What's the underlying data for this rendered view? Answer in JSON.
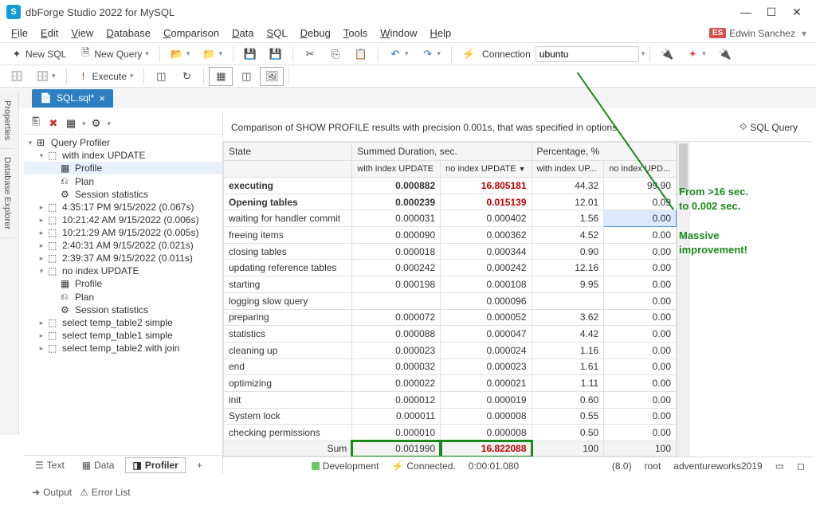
{
  "app": {
    "title": "dbForge Studio 2022 for MySQL",
    "icon_letter": "S"
  },
  "user": {
    "badge": "ES",
    "name": "Edwin Sanchez"
  },
  "menu": [
    "File",
    "Edit",
    "View",
    "Database",
    "Comparison",
    "Data",
    "SQL",
    "Debug",
    "Tools",
    "Window",
    "Help"
  ],
  "toolbar1": {
    "new_sql": "New SQL",
    "new_query": "New Query",
    "connection_label": "Connection",
    "connection_value": "ubuntu"
  },
  "toolbar2": {
    "execute": "Execute"
  },
  "dock_tabs": [
    "Properties",
    "Database Explorer"
  ],
  "document": {
    "tab_label": "SQL.sql*"
  },
  "tree": {
    "root": "Query Profiler",
    "nodes": [
      {
        "d": 1,
        "t": "-",
        "i": "⬚",
        "l": "with index UPDATE"
      },
      {
        "d": 2,
        "t": "",
        "i": "▦",
        "l": "Profile",
        "active": true
      },
      {
        "d": 2,
        "t": "",
        "i": "⎌",
        "l": "Plan"
      },
      {
        "d": 2,
        "t": "",
        "i": "⚙",
        "l": "Session statistics"
      },
      {
        "d": 1,
        "t": "+",
        "i": "⬚",
        "l": "4:35:17 PM 9/15/2022 (0.067s)"
      },
      {
        "d": 1,
        "t": "+",
        "i": "⬚",
        "l": "10:21:42 AM 9/15/2022 (0.006s)"
      },
      {
        "d": 1,
        "t": "+",
        "i": "⬚",
        "l": "10:21:29 AM 9/15/2022 (0.005s)"
      },
      {
        "d": 1,
        "t": "+",
        "i": "⬚",
        "l": "2:40:31 AM 9/15/2022 (0.021s)"
      },
      {
        "d": 1,
        "t": "+",
        "i": "⬚",
        "l": "2:39:37 AM 9/15/2022 (0.011s)"
      },
      {
        "d": 1,
        "t": "-",
        "i": "⬚",
        "l": "no index UPDATE"
      },
      {
        "d": 2,
        "t": "",
        "i": "▦",
        "l": "Profile"
      },
      {
        "d": 2,
        "t": "",
        "i": "⎌",
        "l": "Plan"
      },
      {
        "d": 2,
        "t": "",
        "i": "⚙",
        "l": "Session statistics"
      },
      {
        "d": 1,
        "t": "+",
        "i": "⬚",
        "l": "select temp_table2 simple"
      },
      {
        "d": 1,
        "t": "+",
        "i": "⬚",
        "l": "select temp_table1 simple"
      },
      {
        "d": 1,
        "t": "+",
        "i": "⬚",
        "l": "select temp_table2 with join"
      }
    ]
  },
  "content_header": {
    "text": "Comparison of SHOW PROFILE results with precision 0.001s, that was specified in options",
    "sql_query_btn": "SQL Query"
  },
  "grid": {
    "group_headers": [
      "State",
      "Summed Duration, sec.",
      "Percentage, %"
    ],
    "col_headers": [
      "",
      "with index UPDATE",
      "no index UPDATE",
      "with index UP...",
      "no index UPD..."
    ],
    "rows": [
      {
        "state": "executing",
        "bold": true,
        "c1": "0.000882",
        "c2": "16.805181",
        "c2red": true,
        "c3": "44.32",
        "c4": "99.90"
      },
      {
        "state": "Opening tables",
        "bold": true,
        "c1": "0.000239",
        "c2": "0.015139",
        "c2red": true,
        "c3": "12.01",
        "c4": "0.09"
      },
      {
        "state": "waiting for handler commit",
        "c1": "0.000031",
        "c2": "0.000402",
        "c3": "1.56",
        "c4": "0.00",
        "c4sel": true
      },
      {
        "state": "freeing items",
        "c1": "0.000090",
        "c2": "0.000362",
        "c3": "4.52",
        "c4": "0.00"
      },
      {
        "state": "closing tables",
        "c1": "0.000018",
        "c2": "0.000344",
        "c3": "0.90",
        "c4": "0.00"
      },
      {
        "state": "updating reference tables",
        "c1": "0.000242",
        "c2": "0.000242",
        "c3": "12.16",
        "c4": "0.00"
      },
      {
        "state": "starting",
        "c1": "0.000198",
        "c2": "0.000108",
        "c3": "9.95",
        "c4": "0.00"
      },
      {
        "state": "logging slow query",
        "c1": "",
        "c2": "0.000096",
        "c3": "",
        "c4": "0.00"
      },
      {
        "state": "preparing",
        "c1": "0.000072",
        "c2": "0.000052",
        "c3": "3.62",
        "c4": "0.00"
      },
      {
        "state": "statistics",
        "c1": "0.000088",
        "c2": "0.000047",
        "c3": "4.42",
        "c4": "0.00"
      },
      {
        "state": "cleaning up",
        "c1": "0.000023",
        "c2": "0.000024",
        "c3": "1.16",
        "c4": "0.00"
      },
      {
        "state": "end",
        "c1": "0.000032",
        "c2": "0.000023",
        "c3": "1.61",
        "c4": "0.00"
      },
      {
        "state": "optimizing",
        "c1": "0.000022",
        "c2": "0.000021",
        "c3": "1.11",
        "c4": "0.00"
      },
      {
        "state": "init",
        "c1": "0.000012",
        "c2": "0.000019",
        "c3": "0.60",
        "c4": "0.00"
      },
      {
        "state": "System lock",
        "c1": "0.000011",
        "c2": "0.000008",
        "c3": "0.55",
        "c4": "0.00"
      },
      {
        "state": "checking permissions",
        "c1": "0.000010",
        "c2": "0.000008",
        "c3": "0.50",
        "c4": "0.00"
      }
    ],
    "sum_row": {
      "label": "Sum",
      "c1": "0.001990",
      "c2": "16.822088",
      "c3": "100",
      "c4": "100"
    }
  },
  "annotation": {
    "line1": "From >16 sec.",
    "line2": "to 0.002 sec.",
    "line3": "Massive",
    "line4": "improvement!"
  },
  "panel_tabs": {
    "text": "Text",
    "data": "Data",
    "profiler": "Profiler",
    "add": "+"
  },
  "status": {
    "env": "Development",
    "conn": "Connected.",
    "time": "0:00:01.080",
    "ver": "(8.0)",
    "user": "root",
    "db": "adventureworks2019"
  },
  "output_tabs": {
    "output": "Output",
    "error": "Error List"
  }
}
